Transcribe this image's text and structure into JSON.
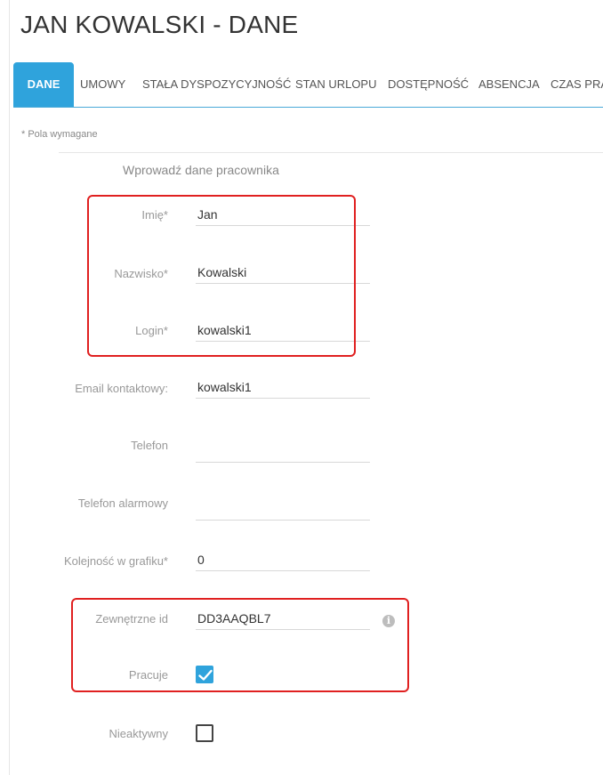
{
  "page": {
    "title": "JAN KOWALSKI - DANE"
  },
  "tabs": [
    {
      "label": "DANE",
      "active": true
    },
    {
      "label": "UMOWY",
      "active": false
    },
    {
      "label": "STAŁA DYSPOZYCYJNOŚĆ",
      "active": false
    },
    {
      "label": "STAN URLOPU",
      "active": false
    },
    {
      "label": "DOSTĘPNOŚĆ",
      "active": false
    },
    {
      "label": "ABSENCJA",
      "active": false
    },
    {
      "label": "CZAS PRA",
      "active": false
    }
  ],
  "form": {
    "required_note": "* Pola wymagane",
    "section_title": "Wprowadź dane pracownika",
    "fields": {
      "imie": {
        "label": "Imię*",
        "value": "Jan"
      },
      "nazwisko": {
        "label": "Nazwisko*",
        "value": "Kowalski"
      },
      "login": {
        "label": "Login*",
        "value": "kowalski1"
      },
      "email": {
        "label": "Email kontaktowy:",
        "value": "kowalski1"
      },
      "telefon": {
        "label": "Telefon",
        "value": ""
      },
      "telefon_alarmowy": {
        "label": "Telefon alarmowy",
        "value": ""
      },
      "kolejnosc": {
        "label": "Kolejność w grafiku*",
        "value": "0"
      },
      "zewnetrzne_id": {
        "label": "Zewnętrzne id",
        "value": "DD3AAQBL7"
      },
      "pracuje": {
        "label": "Pracuje",
        "checked": true
      },
      "nieaktywny": {
        "label": "Nieaktywny",
        "checked": false
      }
    }
  },
  "colors": {
    "accent": "#2fa3dc",
    "highlight": "#e02020"
  },
  "icons": {
    "info": "info-icon",
    "check": "checkmark-icon"
  }
}
